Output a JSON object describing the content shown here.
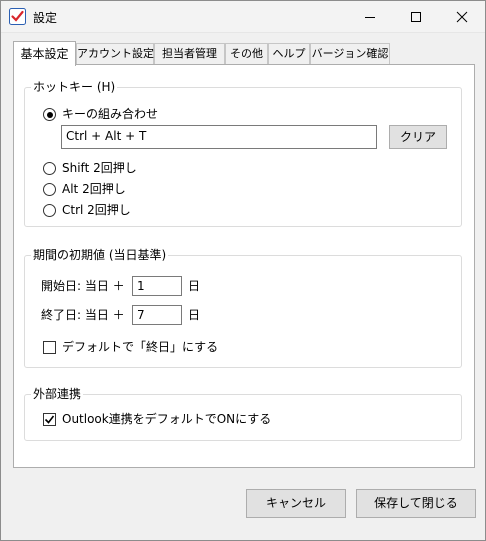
{
  "window": {
    "title": "設定"
  },
  "tabs": [
    {
      "label": "基本設定"
    },
    {
      "label": "アカウント設定"
    },
    {
      "label": "担当者管理"
    },
    {
      "label": "その他"
    },
    {
      "label": "ヘルプ"
    },
    {
      "label": "バージョン確認"
    }
  ],
  "hotkey": {
    "group_label": "ホットキー (H)",
    "combo_label": "キーの組み合わせ",
    "combo_value": "Ctrl + Alt + T",
    "clear_label": "クリア",
    "options": [
      {
        "label": "Shift 2回押し"
      },
      {
        "label": "Alt 2回押し"
      },
      {
        "label": "Ctrl 2回押し"
      }
    ]
  },
  "period": {
    "group_label": "期間の初期値 (当日基準)",
    "start_label": "開始日: 当日 ＋",
    "start_value": "1",
    "start_unit": "日",
    "end_label": "終了日: 当日 ＋",
    "end_value": "7",
    "end_unit": "日",
    "default_end_label": "デフォルトで「終日」にする",
    "default_end_checked": false
  },
  "external": {
    "group_label": "外部連携",
    "outlook_label": "Outlook連携をデフォルトでONにする",
    "outlook_checked": true
  },
  "footer": {
    "cancel_label": "キャンセル",
    "save_label": "保存して閉じる"
  }
}
